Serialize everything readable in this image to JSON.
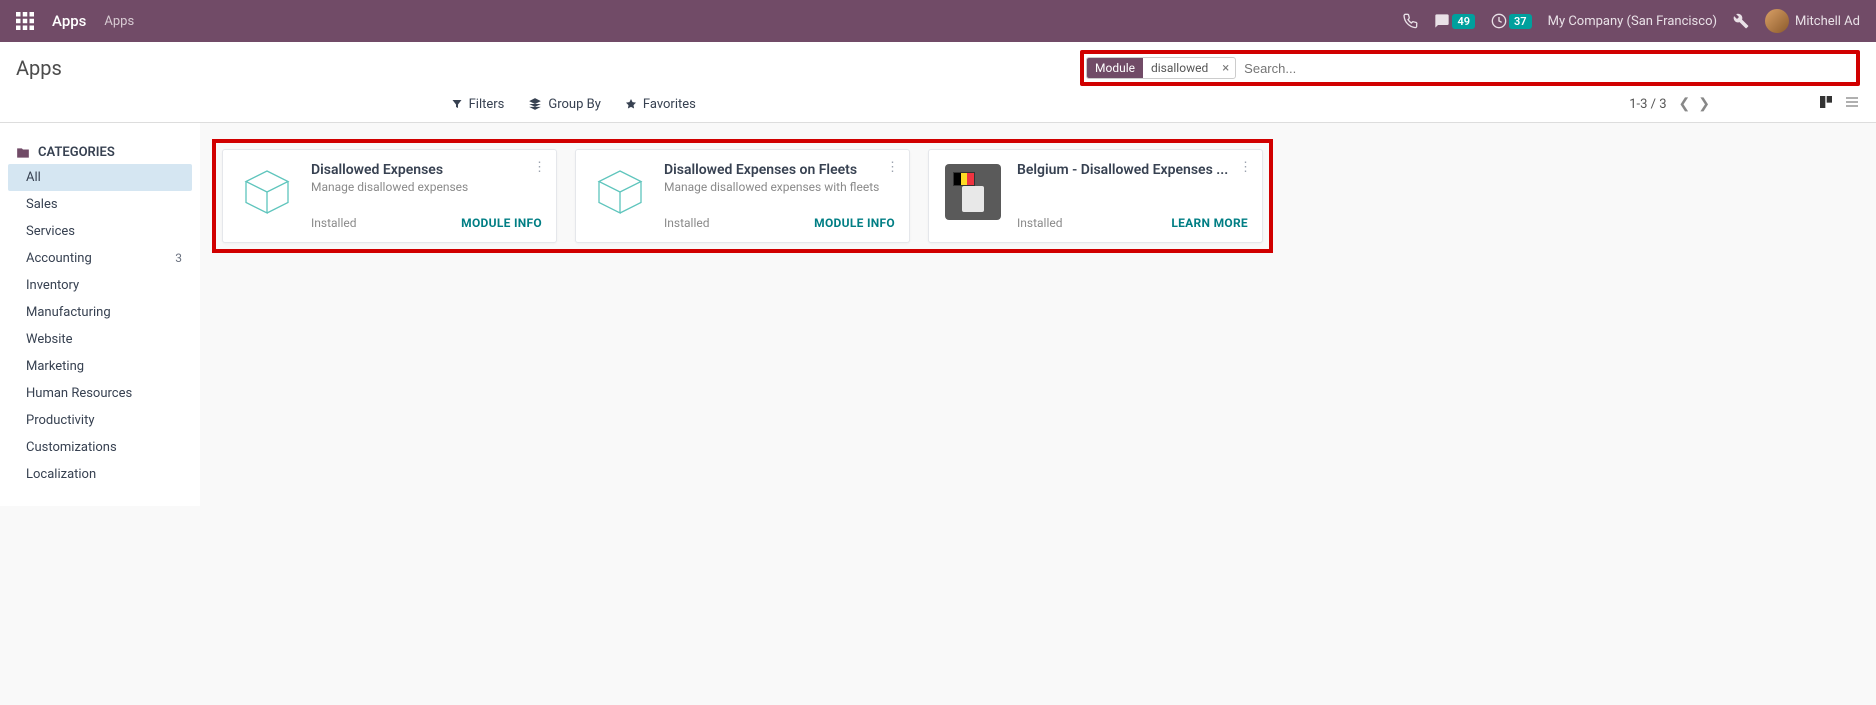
{
  "navbar": {
    "app_title": "Apps",
    "breadcrumb": "Apps",
    "chat_count": "49",
    "activity_count": "37",
    "company": "My Company (San Francisco)",
    "user_name": "Mitchell Ad"
  },
  "control": {
    "page_title": "Apps",
    "search_facet_label": "Module",
    "search_facet_value": "disallowed",
    "search_placeholder": "Search...",
    "filters_label": "Filters",
    "groupby_label": "Group By",
    "favorites_label": "Favorites",
    "pager": "1-3 / 3"
  },
  "sidebar": {
    "heading": "CATEGORIES",
    "items": [
      {
        "label": "All",
        "count": "",
        "active": true
      },
      {
        "label": "Sales",
        "count": ""
      },
      {
        "label": "Services",
        "count": ""
      },
      {
        "label": "Accounting",
        "count": "3"
      },
      {
        "label": "Inventory",
        "count": ""
      },
      {
        "label": "Manufacturing",
        "count": ""
      },
      {
        "label": "Website",
        "count": ""
      },
      {
        "label": "Marketing",
        "count": ""
      },
      {
        "label": "Human Resources",
        "count": ""
      },
      {
        "label": "Productivity",
        "count": ""
      },
      {
        "label": "Customizations",
        "count": ""
      },
      {
        "label": "Localization",
        "count": ""
      }
    ]
  },
  "cards": [
    {
      "title": "Disallowed Expenses",
      "desc": "Manage disallowed expenses",
      "status": "Installed",
      "action": "MODULE INFO",
      "icon": "cube"
    },
    {
      "title": "Disallowed Expenses on Fleets",
      "desc": "Manage disallowed expenses with fleets",
      "status": "Installed",
      "action": "MODULE INFO",
      "icon": "cube"
    },
    {
      "title": "Belgium - Disallowed Expenses ...",
      "desc": "",
      "status": "Installed",
      "action": "LEARN MORE",
      "icon": "belgium"
    }
  ]
}
